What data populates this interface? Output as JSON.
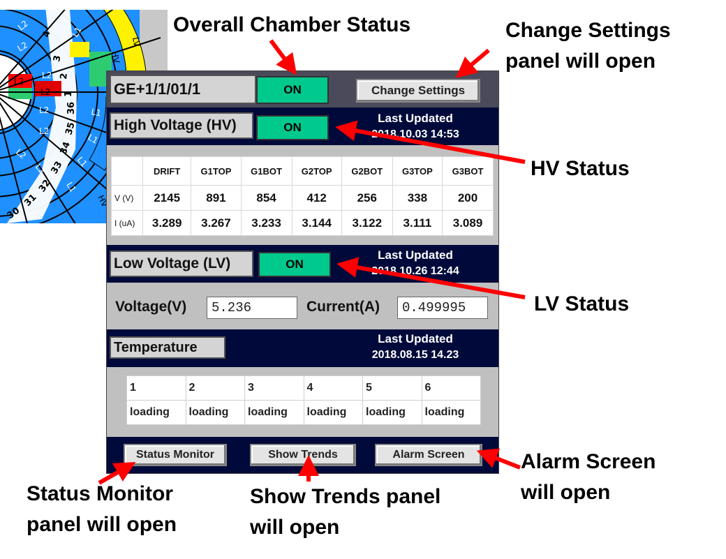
{
  "panel": {
    "chamber_id": "GE+1/1/01/1",
    "overall_status": "ON",
    "change_settings_label": "Change Settings",
    "hv": {
      "title": "High Voltage (HV)",
      "status": "ON",
      "last_updated_label": "Last Updated",
      "last_updated_value": "2018.10.03  14:53",
      "columns": [
        "DRIFT",
        "G1TOP",
        "G1BOT",
        "G2TOP",
        "G2BOT",
        "G3TOP",
        "G3BOT"
      ],
      "rows": [
        {
          "label": "V (V)",
          "values": [
            "2145",
            "891",
            "854",
            "412",
            "256",
            "338",
            "200"
          ]
        },
        {
          "label": "I (uA)",
          "values": [
            "3.289",
            "3.267",
            "3.233",
            "3.144",
            "3.122",
            "3.111",
            "3.089"
          ]
        }
      ]
    },
    "lv": {
      "title": "Low Voltage (LV)",
      "status": "ON",
      "last_updated_label": "Last Updated",
      "last_updated_value": "2018.10.26  12:44",
      "voltage_label": "Voltage(V)",
      "voltage_value": "5.236",
      "current_label": "Current(A)",
      "current_value": "0.499995"
    },
    "temperature": {
      "title": "Temperature",
      "last_updated_label": "Last Updated",
      "last_updated_value": "2018.08.15  14.23",
      "sensors": [
        {
          "id": "1",
          "value": "loading"
        },
        {
          "id": "2",
          "value": "loading"
        },
        {
          "id": "3",
          "value": "loading"
        },
        {
          "id": "4",
          "value": "loading"
        },
        {
          "id": "5",
          "value": "loading"
        },
        {
          "id": "6",
          "value": "loading"
        }
      ]
    },
    "buttons": {
      "status_monitor": "Status Monitor",
      "show_trends": "Show Trends",
      "alarm_screen": "Alarm Screen"
    }
  },
  "callouts": {
    "overall": "Overall Chamber Status",
    "change_settings_1": "Change Settings",
    "change_settings_2": "panel will open",
    "hv_status": "HV Status",
    "lv_status": "LV Status",
    "alarm_1": "Alarm Screen",
    "alarm_2": "will open",
    "status_monitor_1": "Status Monitor",
    "status_monitor_2": "panel will open",
    "show_trends_1": "Show Trends panel",
    "show_trends_2": "will open"
  },
  "wheel": {
    "outer_labels": [
      "LV",
      "HV",
      "HV"
    ],
    "chamber_numbers": [
      "4",
      "3",
      "2",
      "1",
      "36",
      "35",
      "34",
      "33",
      "32",
      "31",
      "30"
    ],
    "segment_labels": [
      "L1",
      "L2",
      "L1",
      "L2",
      "L1",
      "L2",
      "L1",
      "L2",
      "L1",
      "L2",
      "L1",
      "L2",
      "L1",
      "L2"
    ]
  },
  "colors": {
    "navy": "#000a3a",
    "on_green": "#00c98d",
    "arrow_red": "#ff0000",
    "wheel_blue": "#1e90ff",
    "wheel_yellow": "#fff200"
  }
}
